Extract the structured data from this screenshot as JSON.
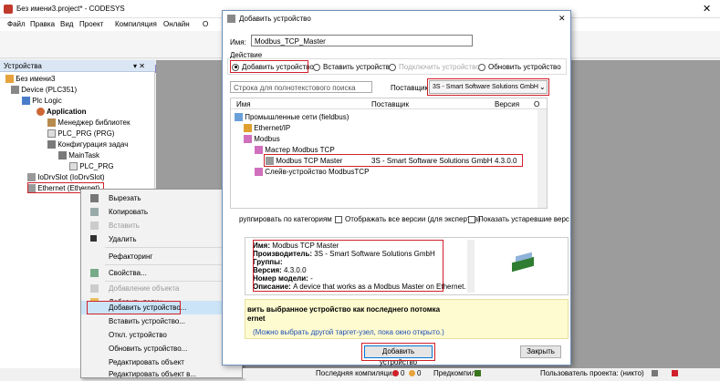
{
  "main_title": "Без имени3.project* - CODESYS",
  "menu": [
    "Файл",
    "Правка",
    "Вид",
    "Проект",
    "Компиляция",
    "Онлайн",
    "О"
  ],
  "devices_panel": {
    "title": "Устройства",
    "pin": "▾ ✕",
    "tree": [
      "Без имени3",
      "Device (PLC351)",
      "Plc Logic",
      "Application",
      "Менеджер библиотек",
      "PLC_PRG (PRG)",
      "Конфигурация задач",
      "MainTask",
      "PLC_PRG",
      "IoDrvSlot (IoDrvSlot)",
      "Ethernet (Ethernet)"
    ]
  },
  "context_menu": {
    "items": [
      "Вырезать",
      "Копировать",
      "Вставить",
      "Удалить",
      "Рефакторинг",
      "Свойства...",
      "Добавление объекта",
      "Добавить папку...",
      "Добавить устройство...",
      "Вставить устройство...",
      "Откл. устройство",
      "Обновить устройство...",
      "Редактировать объект",
      "Редактировать объект в..."
    ],
    "submenu_arrow": "▸"
  },
  "dialog": {
    "title": "Добавить устройство",
    "close": "✕",
    "name_label": "Имя:",
    "name_value": "Modbus_TCP_Master",
    "action_label": "Действие",
    "actions": [
      "Добавить устройство",
      "Вставить устройство",
      "Подключить устройство",
      "Обновить устройство"
    ],
    "search_placeholder": "Строка для полнотекстового поиска",
    "vendor_label": "Поставщик",
    "vendor_value": "3S - Smart Software Solutions GmbH",
    "columns": [
      "Имя",
      "Поставщик",
      "Версия",
      "О"
    ],
    "tree": [
      {
        "name": "Промышленные сети (fieldbus)",
        "vendor": "",
        "version": ""
      },
      {
        "name": "Ethernet/IP",
        "vendor": "",
        "version": ""
      },
      {
        "name": "Modbus",
        "vendor": "",
        "version": ""
      },
      {
        "name": "Мастер Modbus TCP",
        "vendor": "",
        "version": ""
      },
      {
        "name": "Modbus TCP Master",
        "vendor": "3S - Smart Software Solutions GmbH",
        "version": "4.3.0.0"
      },
      {
        "name": "Слейв-устройство ModbusTCP",
        "vendor": "",
        "version": ""
      }
    ],
    "options": [
      "руппировать по категориям",
      "Отображать все версии (для экспертов)",
      "Показать устаревшие верс"
    ],
    "info": [
      [
        "Имя:",
        "Modbus TCP Master"
      ],
      [
        "Производитель:",
        "3S - Smart Software Solutions GmbH"
      ],
      [
        "Группы:",
        ""
      ],
      [
        "Версия:",
        "4.3.0.0"
      ],
      [
        "Номер модели:",
        "-"
      ],
      [
        "Описание:",
        "A device that works as a Modbus Master on Ethernet."
      ]
    ],
    "hint_line1": "вить выбранное устройство как последнего потомка",
    "hint_line2": "ernet",
    "hint_line3": "(Можно выбрать другой таргет-узел, пока окно открыто.)",
    "add_button": "Добавить устройство",
    "close_button": "Закрыть"
  },
  "status": {
    "last_compile": "Последняя компиляция:",
    "errors": "0",
    "warnings": "0",
    "precompile": "Предкомпил.:",
    "user": "Пользователь проекта: (никто)"
  }
}
